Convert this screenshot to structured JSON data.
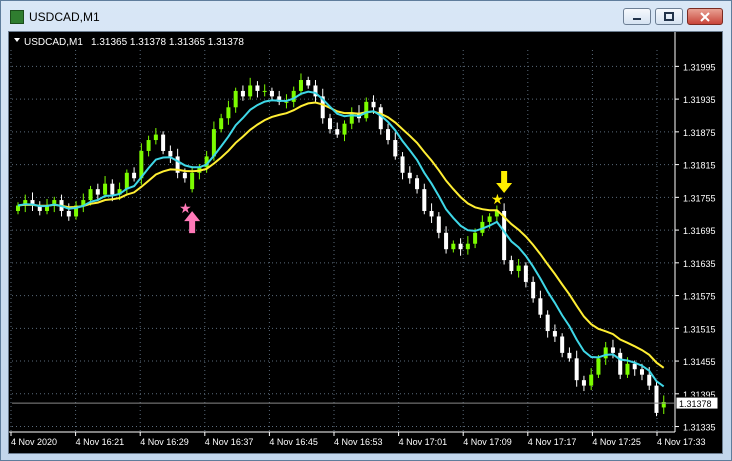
{
  "window": {
    "title": "USDCAD,M1",
    "controls": {
      "minimize": "minimize",
      "maximize": "maximize",
      "close": "close"
    }
  },
  "chart_info": {
    "symbol_label": "USDCAD,M1",
    "ohlc": "1.31365 1.31378 1.31365 1.31378",
    "current_price": "1.31378"
  },
  "colors": {
    "background": "#000000",
    "axis_text": "#ffffff",
    "grid": "#5a6a7a",
    "bull_candle": "#7cfc00",
    "bear_candle": "#ffffff",
    "ma_fast": "#3fd7e7",
    "ma_slow": "#ffee33",
    "buy_signal": "#ff79b8",
    "sell_signal": "#ffee00"
  },
  "chart_data": {
    "type": "candlestick",
    "price_ticks": [
      "1.31995",
      "1.31935",
      "1.31875",
      "1.31815",
      "1.31755",
      "1.31695",
      "1.31635",
      "1.31575",
      "1.31515",
      "1.31455",
      "1.31395",
      "1.31335"
    ],
    "time_labels": [
      "4 Nov 2020",
      "4 Nov 16:21",
      "4 Nov 16:29",
      "4 Nov 16:37",
      "4 Nov 16:45",
      "4 Nov 16:53",
      "4 Nov 17:01",
      "4 Nov 17:09",
      "4 Nov 17:17",
      "4 Nov 17:25",
      "4 Nov 17:33"
    ],
    "ylim": [
      1.31325,
      1.32025
    ],
    "closes": [
      1.3174,
      1.3175,
      1.3174,
      1.3173,
      1.3174,
      1.3175,
      1.3173,
      1.3172,
      1.3174,
      1.3175,
      1.3177,
      1.3176,
      1.3178,
      1.3176,
      1.3177,
      1.318,
      1.3179,
      1.3184,
      1.3186,
      1.3187,
      1.3184,
      1.3183,
      1.318,
      1.3179,
      1.318,
      1.3181,
      1.3183,
      1.3188,
      1.319,
      1.3192,
      1.3195,
      1.3194,
      1.3196,
      1.3195,
      1.3195,
      1.3194,
      1.3193,
      1.3193,
      1.3195,
      1.3197,
      1.3196,
      1.3194,
      1.319,
      1.3188,
      1.3187,
      1.3189,
      1.3191,
      1.319,
      1.3193,
      1.3192,
      1.3188,
      1.3186,
      1.3183,
      1.318,
      1.3179,
      1.3177,
      1.3173,
      1.3172,
      1.3169,
      1.3166,
      1.3167,
      1.3166,
      1.3167,
      1.3169,
      1.3171,
      1.3172,
      1.3173,
      1.3164,
      1.3162,
      1.3163,
      1.316,
      1.3157,
      1.3154,
      1.3151,
      1.315,
      1.3147,
      1.3146,
      1.3142,
      1.3141,
      1.3143,
      1.3146,
      1.3148,
      1.3147,
      1.3143,
      1.3145,
      1.3144,
      1.3143,
      1.3141,
      1.3136,
      1.3138
    ],
    "opens": [
      1.3173,
      1.3174,
      1.3175,
      1.3174,
      1.3173,
      1.3174,
      1.3175,
      1.3173,
      1.3172,
      1.3174,
      1.3175,
      1.3177,
      1.3176,
      1.3178,
      1.3176,
      1.3177,
      1.318,
      1.3179,
      1.3184,
      1.3186,
      1.3187,
      1.3184,
      1.3183,
      1.318,
      1.3177,
      1.318,
      1.3181,
      1.3183,
      1.3188,
      1.319,
      1.3192,
      1.3195,
      1.3194,
      1.3196,
      1.3195,
      1.3195,
      1.3194,
      1.3193,
      1.3193,
      1.3195,
      1.3197,
      1.3196,
      1.3194,
      1.319,
      1.3188,
      1.3187,
      1.3189,
      1.3191,
      1.319,
      1.3193,
      1.3192,
      1.3188,
      1.3186,
      1.3183,
      1.318,
      1.3179,
      1.3177,
      1.3173,
      1.3172,
      1.3169,
      1.3166,
      1.3167,
      1.3166,
      1.3167,
      1.3169,
      1.3171,
      1.3172,
      1.3173,
      1.3164,
      1.3162,
      1.3163,
      1.316,
      1.3157,
      1.3154,
      1.3151,
      1.315,
      1.3147,
      1.3146,
      1.3142,
      1.3141,
      1.3143,
      1.3146,
      1.3148,
      1.3147,
      1.3143,
      1.3145,
      1.3144,
      1.3143,
      1.3141,
      1.3137
    ]
  },
  "signals": [
    {
      "type": "buy",
      "index": 24
    },
    {
      "type": "sell",
      "index": 67
    }
  ]
}
